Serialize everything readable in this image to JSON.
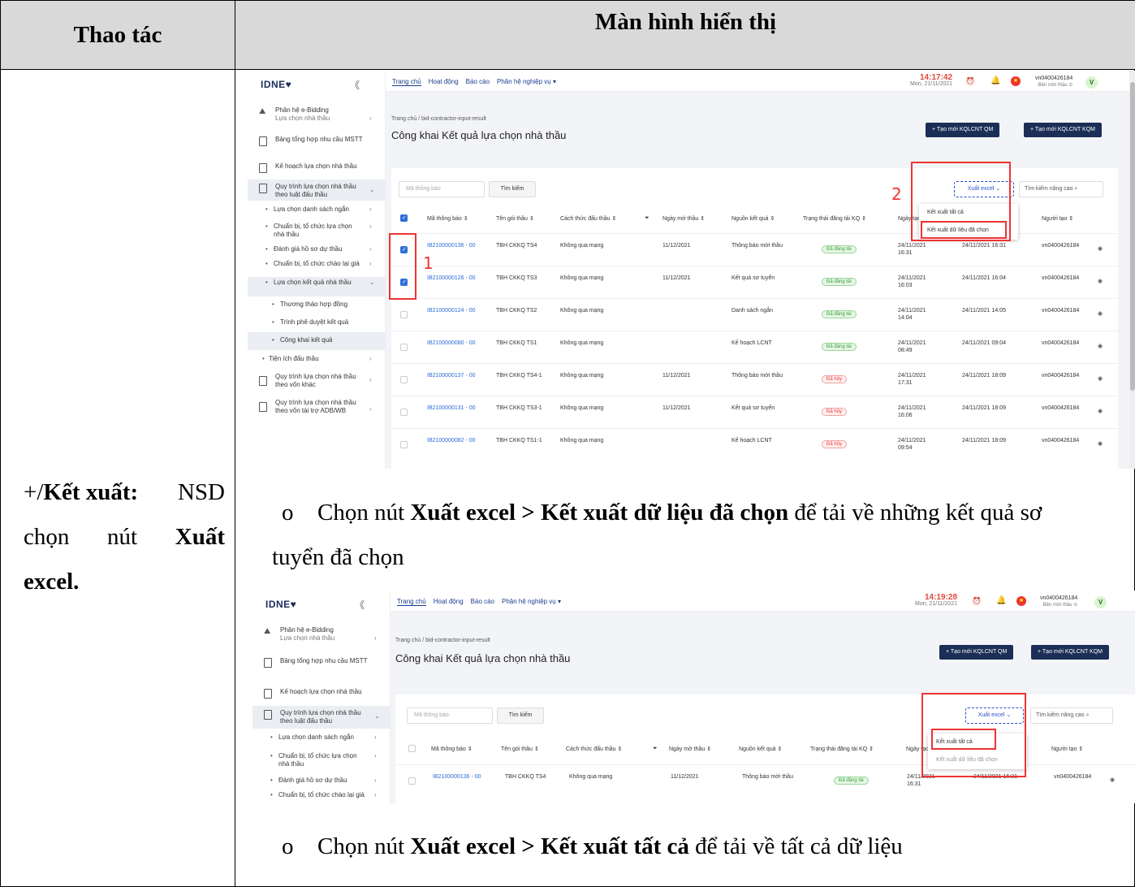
{
  "doc": {
    "header_left": "Thao tác",
    "header_right": "Màn hình hiển thị",
    "left_prefix": "+/",
    "left_bold1": "Kết xuất:",
    "left_w1": "NSD",
    "left_w2": "chọn",
    "left_w3": "nút",
    "left_bold2": "Xuất",
    "left_bold3": "excel.",
    "bullet": "o",
    "para1_a": "Chọn nút ",
    "para1_b": "Xuất excel > Kết xuất dữ liệu đã chọn",
    "para1_c": " để tải về những kết quả sơ",
    "para1_d": "tuyển đã chọn",
    "para2_a": "Chọn nút ",
    "para2_b": "Xuất excel > Kết xuất tất cả",
    "para2_c": " để tải về tất cả dữ liệu"
  },
  "app": {
    "logo": "IDNE♥",
    "collapse": "《",
    "nav": [
      "Trang chủ",
      "Hoạt động",
      "Báo cáo",
      "Phân hệ nghiệp vụ ▾"
    ],
    "sidebar": {
      "module_title": "Phân hệ e-Bidding",
      "module_sub": "Lựa chọn nhà thầu",
      "items": [
        "Bảng tổng hợp nhu cầu MSTT",
        "Kế hoạch lựa chọn nhà thầu",
        "Quy trình lựa chọn nhà thầu theo luật đấu thầu"
      ],
      "sub": [
        "Lựa chọn danh sách ngắn",
        "Chuẩn bị, tổ chức lựa chọn nhà thầu",
        "Đánh giá hồ sơ dự thầu",
        "Chuẩn bị, tổ chức chào lại giá",
        "Lựa chọn kết quả nhà thầu"
      ],
      "sub2": [
        "Thương thảo hợp đồng",
        "Trình phê duyệt kết quả",
        "Công khai kết quả"
      ],
      "more": [
        "Tiện ích đấu thầu",
        "Quy trình lựa chọn nhà thầu theo vốn khác",
        "Quy trình lựa chọn nhà thầu theo vốn tài trợ ADB/WB"
      ]
    },
    "user": "vn0400426184",
    "user_role": "Bên mời thầu ⊙",
    "avatar": "V",
    "breadcrumb": "Trang chủ  /  bid-contractor-input-result",
    "title": "Công khai Kết quả lựa chọn nhà thầu",
    "btn_qm": "+  Tạo mới KQLCNT QM",
    "btn_kqm": "+  Tạo mới KQLCNT KQM",
    "search_placeholder": "Mã thông báo",
    "search_btn": "Tìm kiếm",
    "export_btn": "Xuất excel  ⌄",
    "adv_search": "Tìm kiếm nâng cao ⌕",
    "menu_all": "Kết xuất tất cả",
    "menu_selected": "Kết xuất dữ liệu đã chọn",
    "columns": [
      "Mã thông báo ⇕",
      "Tên gói thầu ⇕",
      "Cách thức đấu thầu ⇕",
      "Ngày mở thầu ⇕",
      "Nguồn kết quả ⇕",
      "Trạng thái đăng tải KQ ⇕",
      "Ngày tạo ⇕",
      "Ngày cập nhật ⇕",
      "Người tạo ⇕"
    ],
    "rows": [
      {
        "code": "IB2100000136 - 00",
        "name": "TBH CKKQ TS4",
        "method": "Không qua mạng",
        "open": "11/12/2021",
        "source": "Thông báo mời thầu",
        "status": "Đã đăng tải",
        "created": "24/11/2021 16:31",
        "updated": "24/11/2021 16:31",
        "user": "vn0400426184"
      },
      {
        "code": "IB2100000126 - 00",
        "name": "TBH CKKQ TS3",
        "method": "Không qua mạng",
        "open": "11/12/2021",
        "source": "Kết quả sơ tuyển",
        "status": "Đã đăng tải",
        "created": "24/11/2021 16:03",
        "updated": "24/11/2021 16:04",
        "user": "vn0400426184"
      },
      {
        "code": "IB2100000124 - 00",
        "name": "TBH CKKQ TS2",
        "method": "Không qua mạng",
        "open": "",
        "source": "Danh sách ngắn",
        "status": "Đã đăng tải",
        "created": "24/11/2021 14:04",
        "updated": "24/11/2021 14:05",
        "user": "vn0400426184"
      },
      {
        "code": "IB2100000080 - 00",
        "name": "TBH CKKQ TS1",
        "method": "Không qua mạng",
        "open": "",
        "source": "Kế hoạch LCNT",
        "status": "Đã đăng tải",
        "created": "24/11/2021 08:49",
        "updated": "24/11/2021 09:04",
        "user": "vn0400426184"
      },
      {
        "code": "IB2100000137 - 00",
        "name": "TBH CKKQ TS4-1",
        "method": "Không qua mạng",
        "open": "11/12/2021",
        "source": "Thông báo mời thầu",
        "status": "Đã hủy",
        "created": "24/11/2021 17:31",
        "updated": "24/11/2021 18:09",
        "user": "vn0400426184"
      },
      {
        "code": "IB2100000131 - 00",
        "name": "TBH CKKQ TS3-1",
        "method": "Không qua mạng",
        "open": "11/12/2021",
        "source": "Kết quả sơ tuyển",
        "status": "Đã hủy",
        "created": "24/11/2021 16:06",
        "updated": "24/11/2021 18:09",
        "user": "vn0400426184"
      },
      {
        "code": "IB2100000082 - 00",
        "name": "TBH CKKQ TS1-1",
        "method": "Không qua mạng",
        "open": "",
        "source": "Kế hoạch LCNT",
        "status": "Đã hủy",
        "created": "24/11/2021 09:54",
        "updated": "24/11/2021 18:09",
        "user": "vn0400426184"
      }
    ]
  },
  "shot1": {
    "time": "14:17:42",
    "date": "Mon, 21/11/2021",
    "annot1": "1",
    "annot2": "2"
  },
  "shot2": {
    "time": "14:19:28",
    "date": "Mon, 21/11/2021"
  }
}
